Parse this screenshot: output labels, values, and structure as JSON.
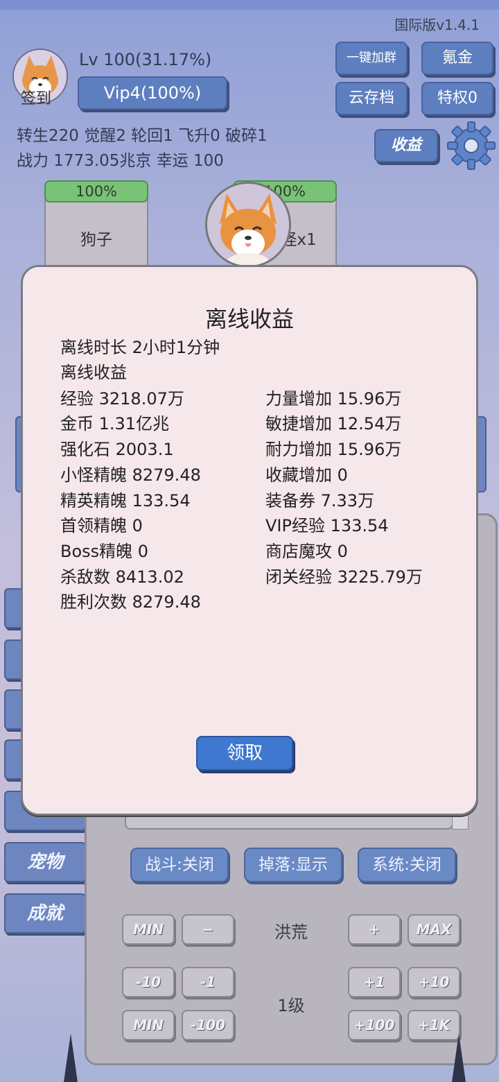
{
  "header": {
    "version": "国际版v1.4.1",
    "avatar_label": "签到",
    "level": "Lv 100(31.17%)",
    "vip": "Vip4(100%)",
    "buttons": {
      "join_group": "一键加群",
      "recharge": "氪金",
      "cloud_save": "云存档",
      "privilege": "特权0",
      "income": "收益"
    },
    "stats_line1": "转生220 觉醒2 轮回1 飞升0 破碎1",
    "stats_line2": "战力 1773.05兆京  幸运 100"
  },
  "cards": [
    {
      "progress": "100%",
      "name": "狗子"
    },
    {
      "progress": "100%",
      "name": "怪x1"
    }
  ],
  "sidebar": [
    "宠物",
    "成就"
  ],
  "panel": {
    "toggles": [
      "战斗:关闭",
      "掉落:显示",
      "系统:关闭"
    ],
    "row1": {
      "min": "MIN",
      "minus": "−",
      "label": "洪荒",
      "plus": "+",
      "max": "MAX"
    },
    "row2": {
      "m10": "-10",
      "m1": "-1",
      "label": "1级",
      "p1": "+1",
      "p10": "+10"
    },
    "row3": {
      "min": "MIN",
      "m100": "-100",
      "p100": "+100",
      "p1k": "+1K"
    }
  },
  "modal": {
    "title": "离线收益",
    "duration": "离线时长 2小时1分钟",
    "subtitle": "离线收益",
    "left": [
      "经验   3218.07万",
      "金币   1.31亿兆",
      "强化石  2003.1",
      "小怪精魄 8279.48",
      "精英精魄 133.54",
      "首领精魄 0",
      "Boss精魄 0",
      "杀敌数  8413.02",
      "胜利次数 8279.48"
    ],
    "right": [
      "力量增加 15.96万",
      "敏捷增加 12.54万",
      "耐力增加 15.96万",
      "收藏增加 0",
      "装备券  7.33万",
      "VIP经验 133.54",
      "商店魔攻 0",
      "闭关经验 3225.79万"
    ],
    "claim": "领取"
  }
}
